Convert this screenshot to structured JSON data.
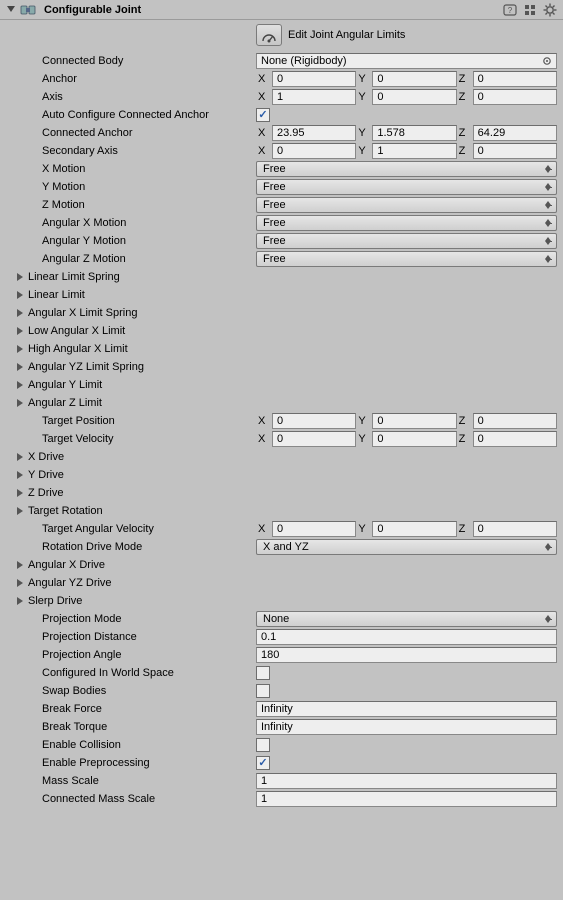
{
  "header": {
    "title": "Configurable Joint"
  },
  "editButton": {
    "label": "Edit Joint Angular Limits"
  },
  "fields": {
    "connectedBody": {
      "label": "Connected Body",
      "value": "None (Rigidbody)"
    },
    "anchor": {
      "label": "Anchor",
      "x": "0",
      "y": "0",
      "z": "0"
    },
    "axis": {
      "label": "Axis",
      "x": "1",
      "y": "0",
      "z": "0"
    },
    "autoConfigure": {
      "label": "Auto Configure Connected Anchor",
      "checked": true
    },
    "connectedAnchor": {
      "label": "Connected Anchor",
      "x": "23.95",
      "y": "1.578",
      "z": "64.29"
    },
    "secondaryAxis": {
      "label": "Secondary Axis",
      "x": "0",
      "y": "1",
      "z": "0"
    },
    "xMotion": {
      "label": "X Motion",
      "value": "Free"
    },
    "yMotion": {
      "label": "Y Motion",
      "value": "Free"
    },
    "zMotion": {
      "label": "Z Motion",
      "value": "Free"
    },
    "angularXMotion": {
      "label": "Angular X Motion",
      "value": "Free"
    },
    "angularYMotion": {
      "label": "Angular Y Motion",
      "value": "Free"
    },
    "angularZMotion": {
      "label": "Angular Z Motion",
      "value": "Free"
    },
    "linearLimitSpring": {
      "label": "Linear Limit Spring"
    },
    "linearLimit": {
      "label": "Linear Limit"
    },
    "angularXLimitSpring": {
      "label": "Angular X Limit Spring"
    },
    "lowAngularXLimit": {
      "label": "Low Angular X Limit"
    },
    "highAngularXLimit": {
      "label": "High Angular X Limit"
    },
    "angularYZLimitSpring": {
      "label": "Angular YZ Limit Spring"
    },
    "angularYLimit": {
      "label": "Angular Y Limit"
    },
    "angularZLimit": {
      "label": "Angular Z Limit"
    },
    "targetPosition": {
      "label": "Target Position",
      "x": "0",
      "y": "0",
      "z": "0"
    },
    "targetVelocity": {
      "label": "Target Velocity",
      "x": "0",
      "y": "0",
      "z": "0"
    },
    "xDrive": {
      "label": "X Drive"
    },
    "yDrive": {
      "label": "Y Drive"
    },
    "zDrive": {
      "label": "Z Drive"
    },
    "targetRotation": {
      "label": "Target Rotation"
    },
    "targetAngularVelocity": {
      "label": "Target Angular Velocity",
      "x": "0",
      "y": "0",
      "z": "0"
    },
    "rotationDriveMode": {
      "label": "Rotation Drive Mode",
      "value": "X and YZ"
    },
    "angularXDrive": {
      "label": "Angular X Drive"
    },
    "angularYZDrive": {
      "label": "Angular YZ Drive"
    },
    "slerpDrive": {
      "label": "Slerp Drive"
    },
    "projectionMode": {
      "label": "Projection Mode",
      "value": "None"
    },
    "projectionDistance": {
      "label": "Projection Distance",
      "value": "0.1"
    },
    "projectionAngle": {
      "label": "Projection Angle",
      "value": "180"
    },
    "configuredInWorldSpace": {
      "label": "Configured In World Space",
      "checked": false
    },
    "swapBodies": {
      "label": "Swap Bodies",
      "checked": false
    },
    "breakForce": {
      "label": "Break Force",
      "value": "Infinity"
    },
    "breakTorque": {
      "label": "Break Torque",
      "value": "Infinity"
    },
    "enableCollision": {
      "label": "Enable Collision",
      "checked": false
    },
    "enablePreprocessing": {
      "label": "Enable Preprocessing",
      "checked": true
    },
    "massScale": {
      "label": "Mass Scale",
      "value": "1"
    },
    "connectedMassScale": {
      "label": "Connected Mass Scale",
      "value": "1"
    }
  },
  "axisLabels": {
    "x": "X",
    "y": "Y",
    "z": "Z"
  }
}
